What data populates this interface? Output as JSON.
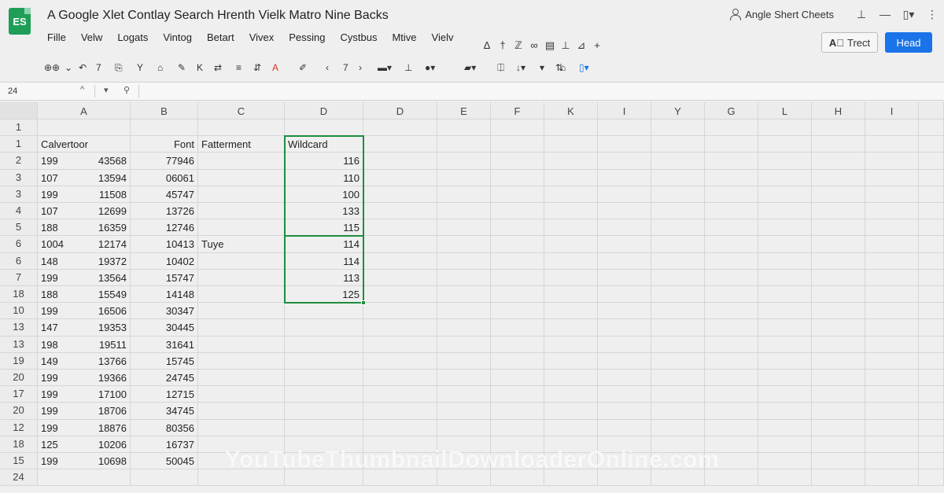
{
  "app": {
    "logo_text": "ES",
    "title": "A Google Xlet Contlay Search Hrenth Vielk Matro Nine Backs",
    "account_name": "Angle Shert Cheets",
    "share_label": "Trect",
    "primary_label": "Head"
  },
  "menu": [
    "Fille",
    "Velw",
    "Logats",
    "Vintog",
    "Betart",
    "Vivex",
    "Pessing",
    "Cystbus",
    "Mtive",
    "Vielv"
  ],
  "formula_bar": {
    "name_box": "24",
    "value": ""
  },
  "columns": [
    "A",
    "B",
    "C",
    "D",
    "D",
    "E",
    "F",
    "K",
    "I",
    "Y",
    "G",
    "L",
    "H",
    "I"
  ],
  "rows": [
    {
      "n": "1",
      "a": "",
      "a2": "",
      "b": "",
      "c": "",
      "d": ""
    },
    {
      "n": "1",
      "a": "Calvertoor",
      "a2": "",
      "b": "Font",
      "c": "Fatterment",
      "d": "Wildcard"
    },
    {
      "n": "2",
      "a": "199",
      "a2": "43568",
      "b": "77946",
      "c": "",
      "d": "116"
    },
    {
      "n": "3",
      "a": "107",
      "a2": "13594",
      "b": "06061",
      "c": "",
      "d": "110"
    },
    {
      "n": "3",
      "a": "199",
      "a2": "11508",
      "b": "45747",
      "c": "",
      "d": "100"
    },
    {
      "n": "4",
      "a": "107",
      "a2": "12699",
      "b": "13726",
      "c": "",
      "d": "133"
    },
    {
      "n": "5",
      "a": "188",
      "a2": "16359",
      "b": "12746",
      "c": "",
      "d": "115"
    },
    {
      "n": "6",
      "a": "1004",
      "a2": "12174",
      "b": "10413",
      "c": "Tuye",
      "d": "114"
    },
    {
      "n": "6",
      "a": "148",
      "a2": "19372",
      "b": "10402",
      "c": "",
      "d": "114"
    },
    {
      "n": "7",
      "a": "199",
      "a2": "13564",
      "b": "15747",
      "c": "",
      "d": "113"
    },
    {
      "n": "18",
      "a": "188",
      "a2": "15549",
      "b": "14148",
      "c": "",
      "d": "125"
    },
    {
      "n": "10",
      "a": "199",
      "a2": "16506",
      "b": "30347",
      "c": "",
      "d": ""
    },
    {
      "n": "13",
      "a": "147",
      "a2": "19353",
      "b": "30445",
      "c": "",
      "d": ""
    },
    {
      "n": "13",
      "a": "198",
      "a2": "19511",
      "b": "31641",
      "c": "",
      "d": ""
    },
    {
      "n": "19",
      "a": "149",
      "a2": "13766",
      "b": "15745",
      "c": "",
      "d": ""
    },
    {
      "n": "20",
      "a": "199",
      "a2": "19366",
      "b": "24745",
      "c": "",
      "d": ""
    },
    {
      "n": "17",
      "a": "199",
      "a2": "17100",
      "b": "12715",
      "c": "",
      "d": ""
    },
    {
      "n": "20",
      "a": "199",
      "a2": "18706",
      "b": "34745",
      "c": "",
      "d": ""
    },
    {
      "n": "12",
      "a": "199",
      "a2": "18876",
      "b": "80356",
      "c": "",
      "d": ""
    },
    {
      "n": "18",
      "a": "125",
      "a2": "10206",
      "b": "16737",
      "c": "",
      "d": ""
    },
    {
      "n": "15",
      "a": "199",
      "a2": "10698",
      "b": "50045",
      "c": "",
      "d": ""
    },
    {
      "n": "24",
      "a": "",
      "a2": "",
      "b": "",
      "c": "",
      "d": ""
    }
  ],
  "watermark": "YouTubeThumbnailDownloaderOnline.com",
  "colors": {
    "accent": "#1a73e8",
    "selection": "#1e8e3e",
    "logo": "#1e9e57"
  }
}
